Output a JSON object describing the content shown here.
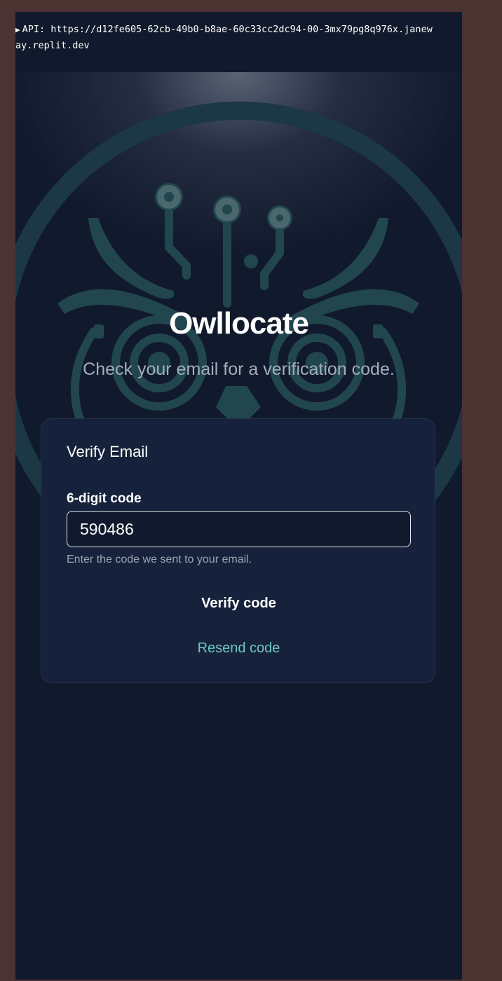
{
  "api_bar": {
    "text": "API: https://d12fe605-62cb-49b0-b8ae-60c33cc2dc94-00-3mx79pg8q976x.janeway.replit.dev",
    "toggle_glyph": "▶"
  },
  "hero": {
    "title": "Owllocate",
    "subtitle": "Check your email for a verification code.",
    "logo_icon": "owl-circuit-icon"
  },
  "verify_card": {
    "title": "Verify Email",
    "code_label": "6-digit code",
    "code_value": "590486",
    "helper_text": "Enter the code we sent to your email.",
    "verify_button_label": "Verify code",
    "resend_button_label": "Resend code"
  },
  "colors": {
    "background": "#111a2c",
    "card": "#16223b",
    "accent_teal": "#6fc6c0",
    "logo_teal": "#2a5158",
    "frame": "#4a3330"
  }
}
